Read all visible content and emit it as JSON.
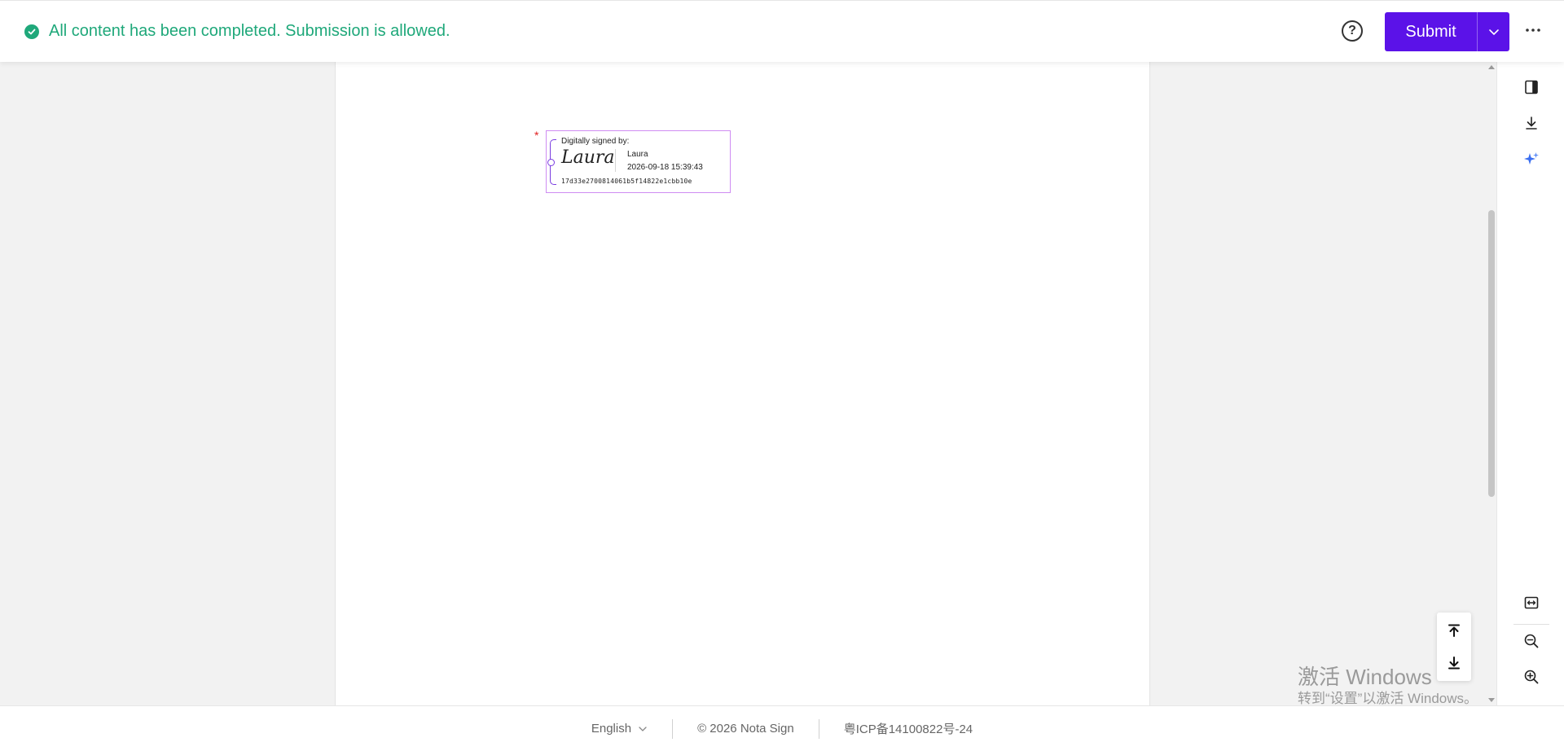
{
  "header": {
    "status_message": "All content has been completed. Submission is allowed.",
    "help_label": "?",
    "submit_label": "Submit",
    "more_icon": "more-horizontal-icon"
  },
  "signature": {
    "heading": "Digitally signed by:",
    "script_name": "Laura",
    "name": "Laura",
    "timestamp": "2026-09-18 15:39:43",
    "hash": "17d33e2700814061b5f14822e1cbb10e",
    "required_mark": "*",
    "border_color": "#cf8cf2",
    "accent_color": "#7a3de0"
  },
  "watermark": {
    "line1": "激活 Windows",
    "line2": "转到“设置”以激活 Windows。"
  },
  "footer": {
    "language": "English",
    "copyright": "© 2026 Nota Sign",
    "icp": "粤ICP备14100822号-24"
  },
  "colors": {
    "primary": "#5b12e8",
    "success": "#1fa87a"
  }
}
